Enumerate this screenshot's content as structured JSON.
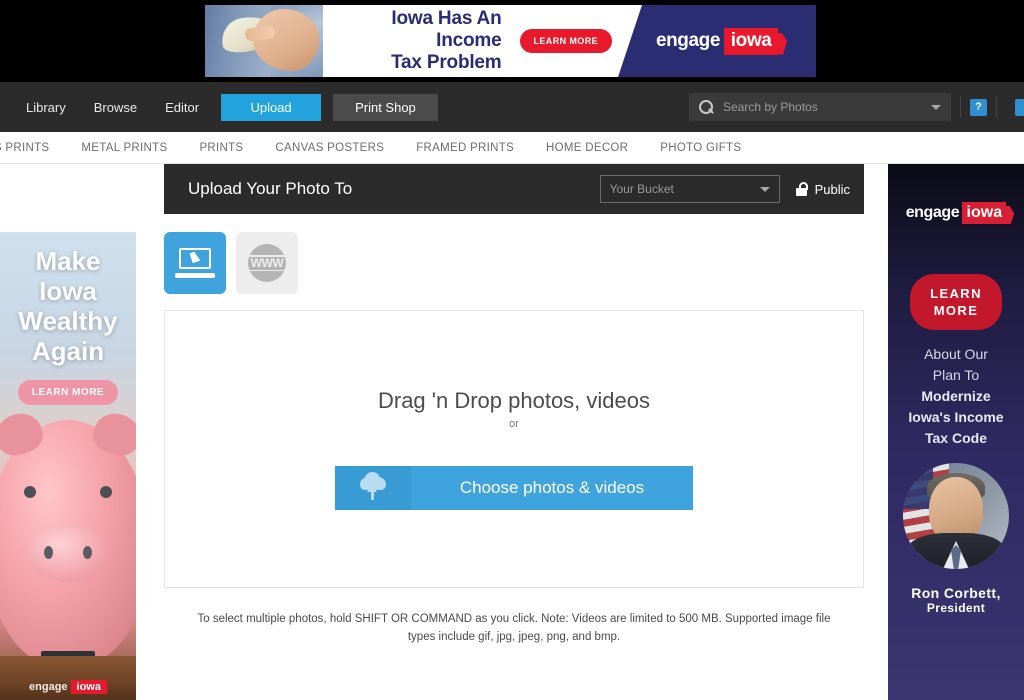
{
  "top_ad": {
    "headline_line1": "Iowa Has An Income",
    "headline_line2": "Tax Problem",
    "cta": "LEARN MORE",
    "brand_part1": "engage",
    "brand_part2": "iowa"
  },
  "navbar": {
    "links": [
      {
        "label": "Library"
      },
      {
        "label": "Browse"
      },
      {
        "label": "Editor"
      }
    ],
    "upload_button": "Upload",
    "printshop_button": "Print Shop",
    "search": {
      "placeholder": "Search by Photos",
      "value": "",
      "icon": "search-icon",
      "caret": "chevron-down-icon"
    },
    "help_icon_label": "?",
    "accent_color": "#22a3dd",
    "background_color": "#2b2b2b"
  },
  "categories": [
    {
      "label": "AS PRINTS"
    },
    {
      "label": "METAL PRINTS"
    },
    {
      "label": "PRINTS"
    },
    {
      "label": "CANVAS POSTERS"
    },
    {
      "label": "FRAMED PRINTS"
    },
    {
      "label": "HOME DECOR"
    },
    {
      "label": "PHOTO GIFTS"
    }
  ],
  "panel": {
    "title": "Upload Your Photo To",
    "bucket_placeholder": "Your Bucket",
    "visibility_label": "Public",
    "visibility_icon": "unlocked-padlock-icon",
    "sources": [
      {
        "name": "computer",
        "icon": "laptop-icon",
        "active": true
      },
      {
        "name": "web",
        "icon": "www-globe-icon",
        "label": "WWW",
        "active": false
      }
    ],
    "dropzone": {
      "title": "Drag 'n Drop photos, videos",
      "or": "or",
      "button_label": "Choose photos & videos",
      "button_icon": "cloud-upload-icon",
      "button_color": "#3fa4dd"
    },
    "help_text": "To select multiple photos, hold SHIFT OR COMMAND as you click. Note: Videos are limited to 500 MB. Supported image file types include gif, jpg, jpeg, png, and bmp."
  },
  "left_ad": {
    "headline_line1": "Make",
    "headline_line2": "Iowa",
    "headline_line3": "Wealthy",
    "headline_line4": "Again",
    "cta": "LEARN MORE",
    "brand_part1": "engage",
    "brand_part2": "iowa"
  },
  "right_ad": {
    "brand_part1": "engage",
    "brand_part2": "iowa",
    "cta_line1": "LEARN",
    "cta_line2": "MORE",
    "body_line1": "About Our",
    "body_line2": "Plan To",
    "body_line3": "Modernize",
    "body_line4": "Iowa's Income",
    "body_line5": "Tax Code",
    "person_name": "Ron Corbett,",
    "person_role": "President"
  }
}
